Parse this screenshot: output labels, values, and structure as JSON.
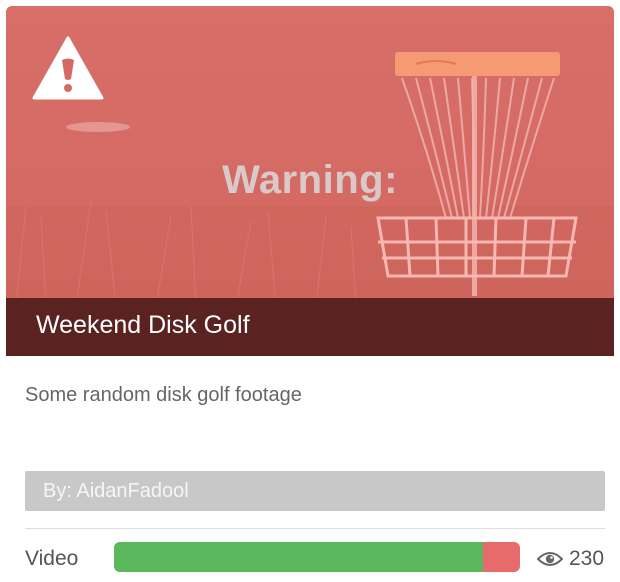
{
  "card": {
    "warning_label": "Warning:",
    "title": "Weekend Disk Golf",
    "description": "Some random disk golf footage",
    "author": "By: AidanFadool",
    "type": "Video",
    "views": "230",
    "like_ratio": 0.91
  },
  "icons": {
    "warning": "warning-triangle-icon",
    "views": "eye-icon"
  },
  "colors": {
    "overlay_red": "#d46a63",
    "title_bar": "#5a2322",
    "like_green": "#5cb85c",
    "dislike_red": "#e86b6b",
    "author_bar": "#c8c8c8"
  }
}
